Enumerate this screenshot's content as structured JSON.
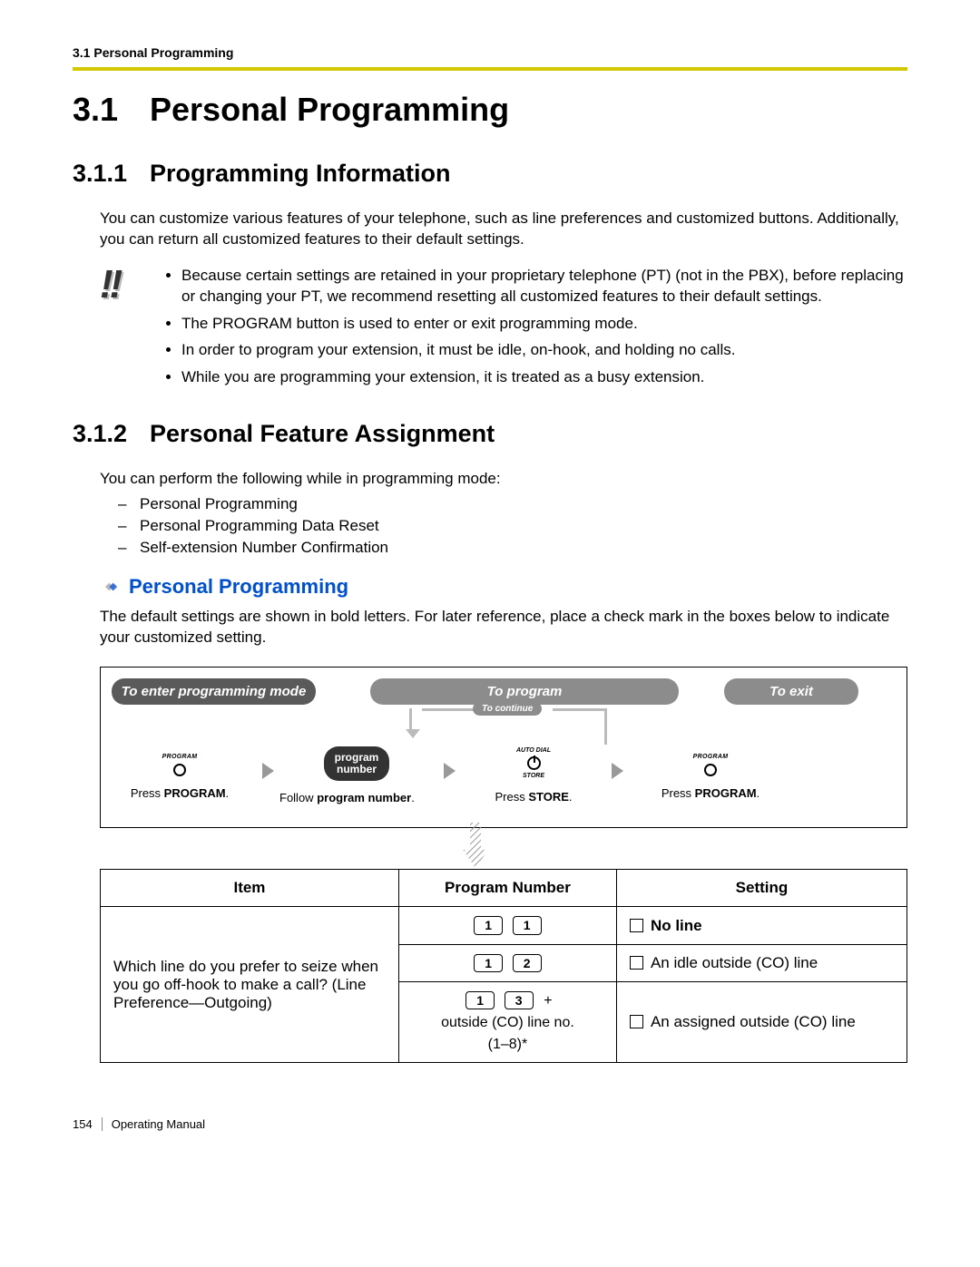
{
  "header": {
    "running": "3.1 Personal Programming"
  },
  "h1": {
    "num": "3.1",
    "title": "Personal Programming"
  },
  "s311": {
    "num": "3.1.1",
    "title": "Programming Information",
    "intro": "You can customize various features of your telephone, such as line preferences and customized buttons. Additionally, you can return all customized features to their default settings.",
    "bullets": [
      "Because certain settings are retained in your proprietary telephone (PT) (not in the PBX), before replacing or changing your PT, we recommend resetting all customized features to their default settings.",
      "The PROGRAM button is used to enter or exit programming mode.",
      "In order to program your extension, it must be idle, on-hook, and holding no calls.",
      "While you are programming your extension, it is treated as a busy extension."
    ]
  },
  "s312": {
    "num": "3.1.2",
    "title": "Personal Feature Assignment",
    "intro": "You can perform the following while in programming mode:",
    "dashes": [
      "Personal Programming",
      "Personal Programming Data Reset",
      "Self-extension Number Confirmation"
    ]
  },
  "subhead": {
    "title": "Personal Programming"
  },
  "default_text": "The default settings are shown in bold letters. For later reference, place a check mark in the boxes below to indicate your customized setting.",
  "flow": {
    "pill_enter": "To enter programming mode",
    "pill_program": "To program",
    "pill_exit": "To exit",
    "continue": "To continue",
    "step1_label": "PROGRAM",
    "step1_cap_a": "Press ",
    "step1_cap_b": "PROGRAM",
    "step1_cap_c": ".",
    "step2_btn_l1": "program",
    "step2_btn_l2": "number",
    "step2_cap_a": "Follow ",
    "step2_cap_b": "program number",
    "step2_cap_c": ".",
    "step3_top": "AUTO DIAL",
    "step3_bot": "STORE",
    "step3_cap_a": "Press ",
    "step3_cap_b": "STORE",
    "step3_cap_c": ".",
    "step4_label": "PROGRAM",
    "step4_cap_a": "Press ",
    "step4_cap_b": "PROGRAM",
    "step4_cap_c": "."
  },
  "table": {
    "h_item": "Item",
    "h_pn": "Program Number",
    "h_set": "Setting",
    "item_text": "Which line do you prefer to seize when you go off-hook to make a call? (Line Preference—Outgoing)",
    "r1k1": "1",
    "r1k2": "1",
    "r1set": "No line",
    "r2k1": "1",
    "r2k2": "2",
    "r2set": "An idle outside (CO) line",
    "r3k1": "1",
    "r3k2": "3",
    "r3plus": "+",
    "r3extra1": "outside (CO) line no.",
    "r3extra2": "(1–8)*",
    "r3set": "An assigned outside (CO) line"
  },
  "footer": {
    "page": "154",
    "manual": "Operating Manual"
  }
}
